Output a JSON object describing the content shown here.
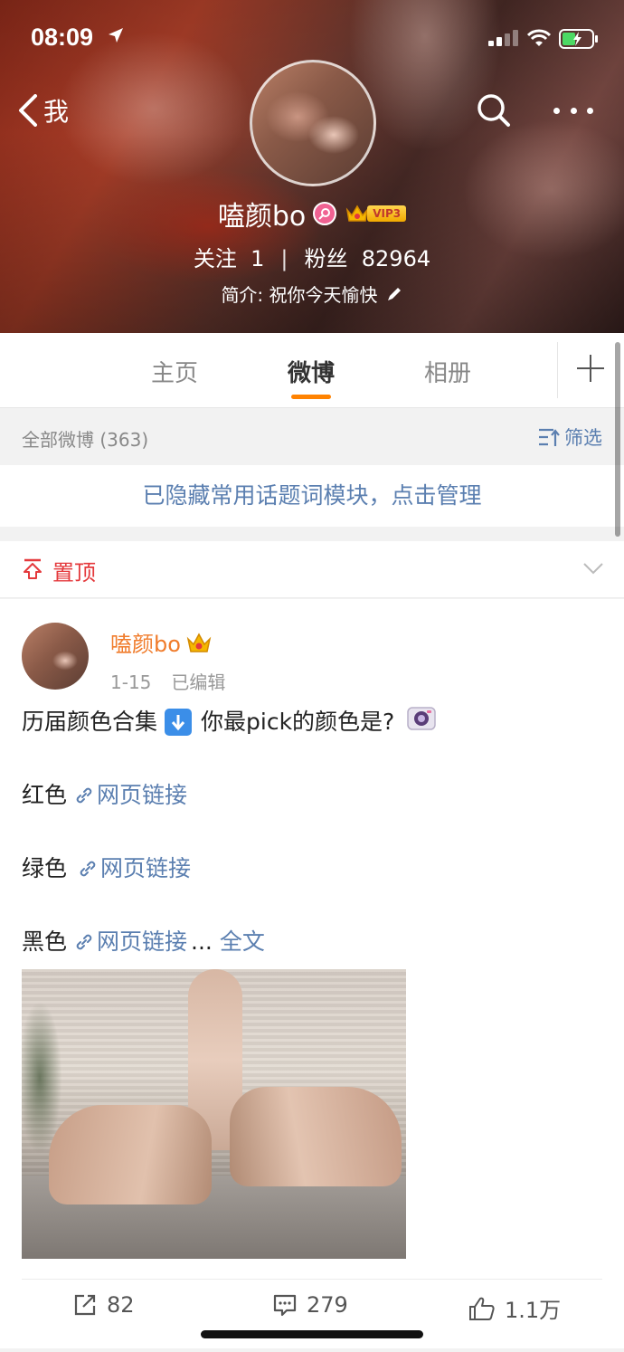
{
  "status_bar": {
    "time": "08:09"
  },
  "nav": {
    "back_label": "我"
  },
  "profile": {
    "username": "嗑颜bo",
    "vip_level": "VIP3",
    "following_label": "关注",
    "following_count": "1",
    "divider": "|",
    "followers_label": "粉丝",
    "followers_count": "82964",
    "bio": "简介: 祝你今天愉快"
  },
  "tabs": [
    {
      "label": "主页"
    },
    {
      "label": "微博"
    },
    {
      "label": "相册"
    }
  ],
  "active_tab": "微博",
  "filter_bar": {
    "all_posts": "全部微博 (363)",
    "filter_label": "筛选"
  },
  "topic_notice": "已隐藏常用话题词模块，点击管理",
  "pinned": {
    "label": "置顶"
  },
  "post": {
    "author": "嗑颜bo",
    "date": "1-15",
    "edited": "已编辑",
    "line1_before": "历届颜色合集",
    "line1_after": "你最pick的颜色是?",
    "lines": [
      {
        "color": "红色",
        "link": "网页链接"
      },
      {
        "color": "绿色",
        "link": "网页链接"
      },
      {
        "color": "黑色",
        "link": "网页链接"
      }
    ],
    "ellipsis": "...",
    "full_text": "全文",
    "reposts": "82",
    "comments": "279",
    "likes": "1.1万"
  },
  "colors": {
    "accent_orange": "#ff8200",
    "link_blue": "#5b7fb0",
    "pinned_red": "#e4393c",
    "author_orange": "#f07b2a"
  }
}
